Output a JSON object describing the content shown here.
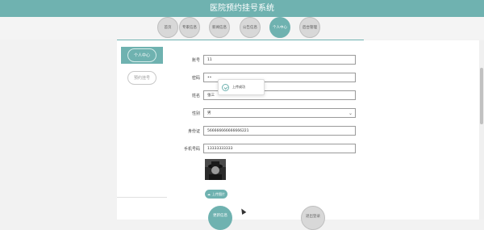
{
  "header": {
    "title": "医院预约挂号系统"
  },
  "nav": {
    "items": [
      {
        "label": "首页",
        "active": false
      },
      {
        "label": "专家信息",
        "active": false
      },
      {
        "label": "新闻信息",
        "active": false
      },
      {
        "label": "公告信息",
        "active": false
      },
      {
        "label": "个人中心",
        "active": true
      },
      {
        "label": "后台管理",
        "active": false
      }
    ]
  },
  "sidebar": {
    "items": [
      {
        "label": "个人中心",
        "active": true
      },
      {
        "label": "预约挂号",
        "active": false
      }
    ]
  },
  "form": {
    "account": {
      "label": "账号",
      "value": "11"
    },
    "password": {
      "label": "密码",
      "value": "••"
    },
    "name": {
      "label": "姓名",
      "value": "张三"
    },
    "gender": {
      "label": "性别",
      "value": "男"
    },
    "id_card": {
      "label": "身份证",
      "value": "566666666666666221"
    },
    "phone": {
      "label": "手机号码",
      "value": "13333333333"
    },
    "upload_label": "上传图片"
  },
  "toast": {
    "text": "上传成功"
  },
  "actions": {
    "update_label": "更新信息",
    "logout_label": "退出登录"
  },
  "colors": {
    "accent": "#6fb2b0"
  }
}
